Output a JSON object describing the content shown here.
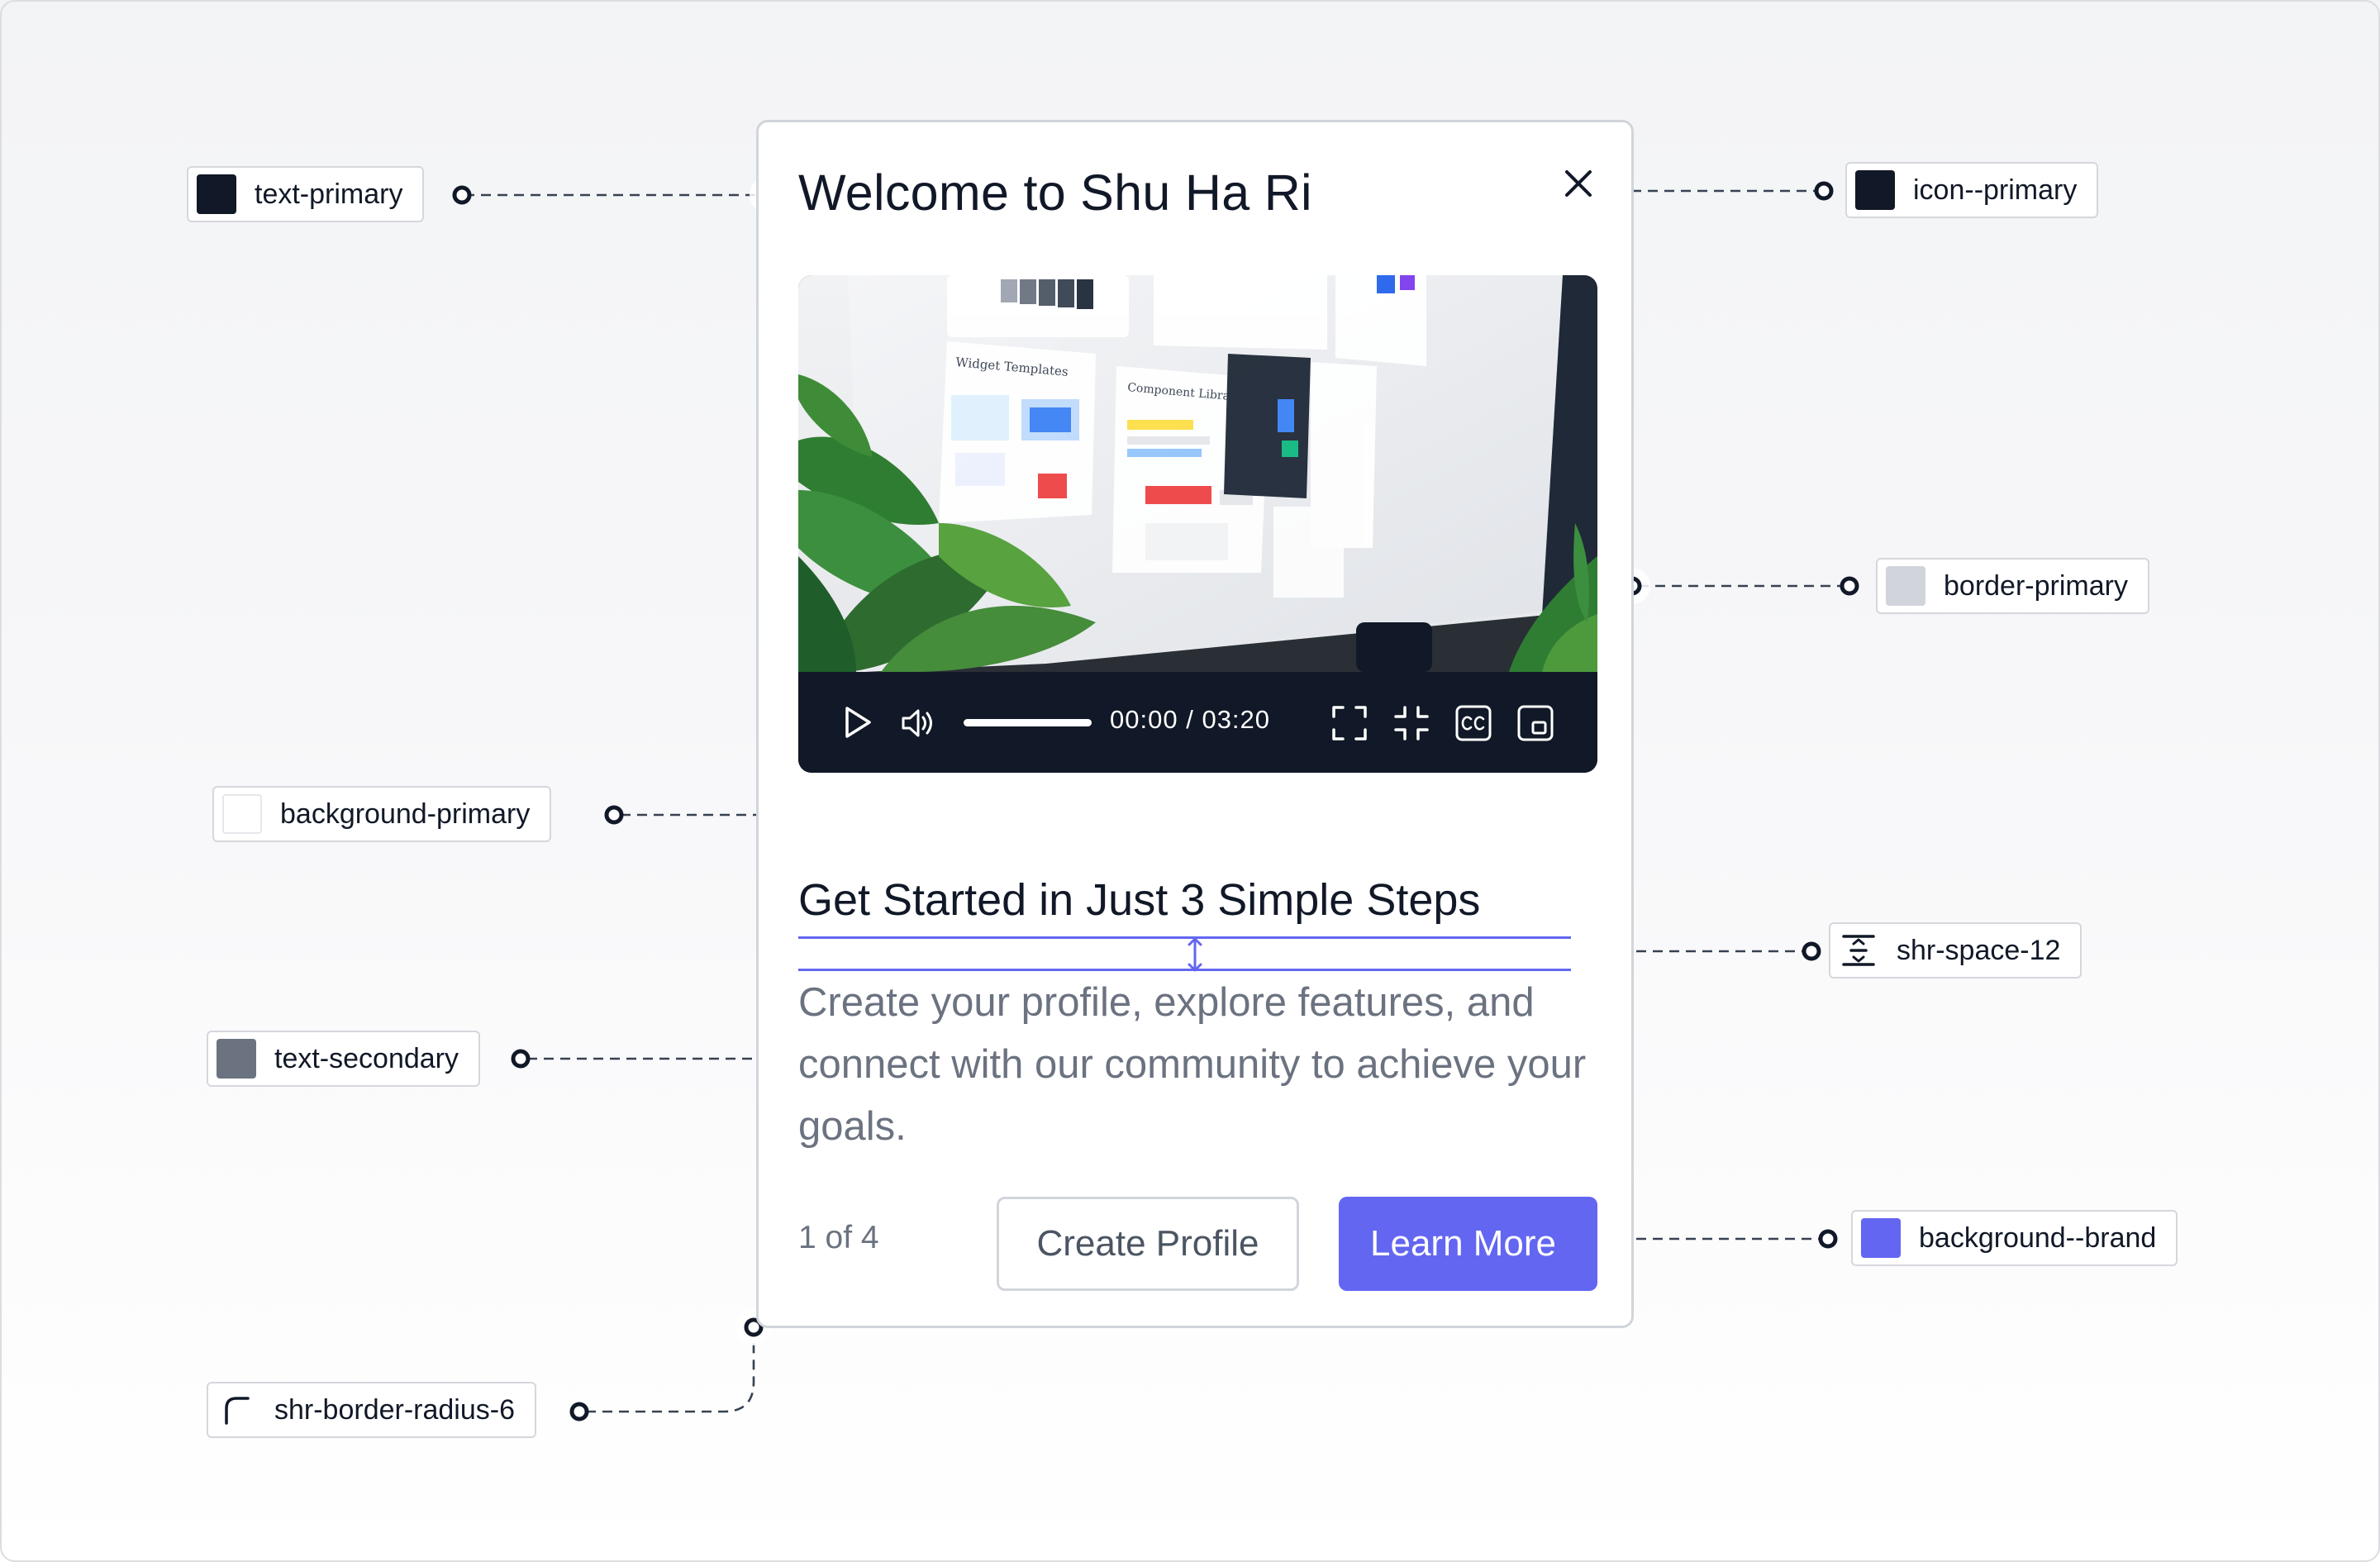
{
  "modal": {
    "title": "Welcome to Shu Ha Ri",
    "video": {
      "current_time": "00:00",
      "separator": "/",
      "duration": "03:20",
      "progress": 1.0,
      "image_texts": {
        "panel_left_title": "Widget Templates",
        "panel_mid_title": "Component Library"
      }
    },
    "heading": "Get Started in Just 3 Simple Steps",
    "body": "Create your profile, explore features, and connect with our community to achieve your goals.",
    "step_counter": "1 of 4",
    "buttons": {
      "create_profile": "Create Profile",
      "learn_more": "Learn More"
    }
  },
  "annotations": {
    "text_primary": "text-primary",
    "icon_primary": "icon--primary",
    "border_primary": "border-primary",
    "background_primary": "background-primary",
    "shr_space": "shr-space-12",
    "text_secondary": "text-secondary",
    "background_brand": "background--brand",
    "border_radius": "shr-border-radius-6"
  },
  "colors": {
    "text_primary": "#111827",
    "icon_primary": "#111827",
    "border_primary": "#d1d5db",
    "background_primary": "#ffffff",
    "text_secondary": "#6b7280",
    "background_brand": "#6366f1",
    "spacing_guide": "#6366f1"
  },
  "icons": {
    "close": "close-icon",
    "play": "play-icon",
    "volume": "volume-icon",
    "fullscreen": "fullscreen-icon",
    "exit_fullscreen": "exit-fullscreen-icon",
    "captions": "captions-icon",
    "picture_in_picture": "picture-in-picture-icon",
    "spacing": "spacing-icon",
    "radius": "radius-corner-icon"
  }
}
